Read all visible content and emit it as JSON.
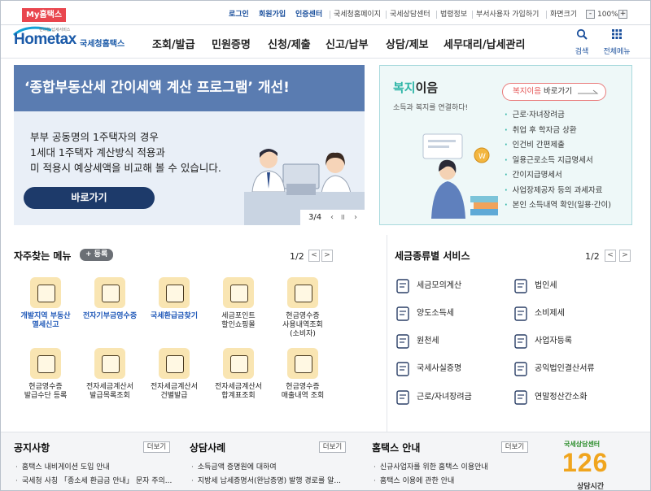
{
  "topbar": {
    "my_hometax": "My홈택스",
    "links": [
      "로그인",
      "회원가입",
      "인증센터",
      "국세청홈페이지",
      "국세상담센터",
      "법령정보",
      "부서사용자 가입하기",
      "화면크기"
    ],
    "zoom_minus": "-",
    "zoom_value": "100%",
    "zoom_plus": "+"
  },
  "header": {
    "logo_text": "Hometax",
    "logo_sub": "편리한 납세서비스",
    "logo_kr": "국세청홈택스",
    "nav": [
      "조회/발급",
      "민원증명",
      "신청/제출",
      "신고/납부",
      "상담/제보",
      "세무대리/납세관리"
    ],
    "search_label": "검색",
    "menu_label": "전체메뉴"
  },
  "banner": {
    "headline": "‘종합부동산세 간이세액 계산 프로그램’ 개선!",
    "desc_lines": [
      "부부 공동명의 1주택자의 경우",
      "1세대 1주택자 계산방식 적용과",
      "미 적용시 예상세액을 비교해 볼 수 있습니다."
    ],
    "button": "바로가기",
    "page": "3/4",
    "prev": "‹",
    "pause": "II",
    "next": "›"
  },
  "welfare": {
    "title_green": "복지",
    "title_rest": "이음",
    "subtitle": "소득과 복지를 연결하다!",
    "button_highlight": "복지이음",
    "button_rest": " 바로가기",
    "items": [
      "근로·자녀장려금",
      "취업 후 학자금 상환",
      "인건비 간편제출",
      "일용근로소득 지급명세서",
      "간이지급명세서",
      "사업장제공자 등의 과세자료",
      "본인 소득내역 확인(일용·간이)"
    ]
  },
  "quick_menu": {
    "title": "자주찾는 메뉴",
    "register": "+ 등록",
    "page": "1/2",
    "items": [
      {
        "label": "개발지역 부동산\n멸세신고",
        "highlight": true
      },
      {
        "label": "전자기부금영수증",
        "highlight": true
      },
      {
        "label": "국세환급금찾기",
        "highlight": true
      },
      {
        "label": "세금포인트\n할인쇼핑몰",
        "highlight": false
      },
      {
        "label": "현금영수증\n사용내역조회\n(소비자)",
        "highlight": false
      },
      {
        "label": "현금영수증\n발급수단 등록",
        "highlight": false
      },
      {
        "label": "전자세금계산서\n발급목록조회",
        "highlight": false
      },
      {
        "label": "전자세금계산서\n건별발급",
        "highlight": false
      },
      {
        "label": "전자세금계산서\n합계표조회",
        "highlight": false
      },
      {
        "label": "현금영수증\n매출내역 조회",
        "highlight": false
      }
    ]
  },
  "tax_services": {
    "title": "세금종류별 서비스",
    "page": "1/2",
    "items": [
      "세금모의계산",
      "법인세",
      "양도소득세",
      "소비제세",
      "원천세",
      "사업자등록",
      "국세사실증명",
      "공익법인결산서류",
      "근로/자녀장려금",
      "연말정산간소화"
    ]
  },
  "bottom": {
    "notice": {
      "title": "공지사항",
      "more": "더보기",
      "items": [
        "홈택스 내비게이션 도입 안내",
        "국세청 사칭 「종소세 환급금 안내」 문자 주의..."
      ]
    },
    "consult": {
      "title": "상담사례",
      "more": "더보기",
      "items": [
        "소득금액 증명원에 대하여",
        "지방세 납세증명서(완납증명) 발행 경로를 알..."
      ]
    },
    "guide": {
      "title": "홈택스 안내",
      "more": "더보기",
      "items": [
        "신규사업자를 위한 홈택스 이용안내",
        "홈택스 이용에 관한 안내"
      ]
    },
    "callcenter": {
      "subtitle": "국세상담센터",
      "number": "126",
      "label": "상담시간"
    }
  },
  "colors": {
    "brand_blue": "#1b5aa8",
    "banner_head": "#5a7cb1",
    "banner_btn": "#1d3a6a",
    "accent_red": "#e9464e",
    "teal": "#30b6a8"
  }
}
